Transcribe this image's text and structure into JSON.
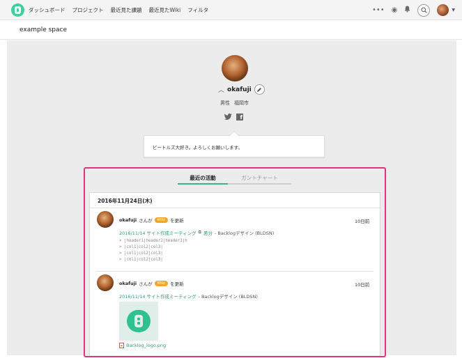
{
  "nav": {
    "items": [
      "ダッシュボード",
      "プロジェクト",
      "最近見た課題",
      "最近見たWiki",
      "フィルタ"
    ],
    "more_icon": "more-dots-icon",
    "watch_icon": "eye-icon",
    "notify_icon": "bell-icon",
    "search_icon": "search-icon"
  },
  "space": {
    "name": "example space"
  },
  "profile": {
    "username": "okafuji",
    "gender": "男性",
    "location": "福岡市",
    "bio": "ビートルズ大好き。よろしくお願いします。"
  },
  "tabs": [
    {
      "label": "最近の活動",
      "active": true
    },
    {
      "label": "ガントチャート",
      "active": false
    }
  ],
  "activity": {
    "date_header": "2016年11月24日(木)",
    "entries": [
      {
        "user": "okafuji",
        "suffix": "さんが",
        "badge": "Wiki",
        "action": "を更新",
        "when": "10日前",
        "page": "2016/11/14 サイト作成ミーティング",
        "diff_label": "差分",
        "project": "- Backlogデザイン (BLDSN)",
        "diff_lines": [
          "> |header1|header2|header3|h",
          "> |col1|col2|col3|",
          "> |col1|col2|col3|",
          "> |col1|col2|col3|"
        ]
      },
      {
        "user": "okafuji",
        "suffix": "さんが",
        "badge": "Wiki",
        "action": "を更新",
        "when": "10日前",
        "page": "2016/11/14 サイト作成ミーティング",
        "project": "- Backlogデザイン (BLDSN)",
        "attachment": "Backlog_logo.png"
      }
    ]
  },
  "colors": {
    "brand": "#42ce9f",
    "link": "#2e9a7d",
    "wiki_badge": "#f5a623",
    "highlight": "#e0347a"
  }
}
